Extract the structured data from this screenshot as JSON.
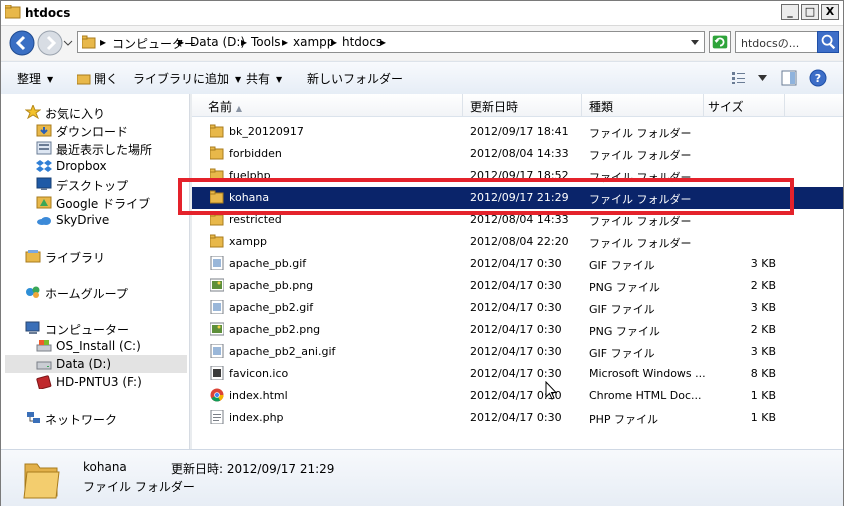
{
  "window": {
    "title": "htdocs",
    "controls": {
      "minimize": "_",
      "maximize": "□",
      "close": "X"
    }
  },
  "address": {
    "crumbs": [
      "コンピューター",
      "Data (D:)",
      "Tools",
      "xampp",
      "htdocs"
    ],
    "separator": "▸",
    "search_placeholder": "htdocsの..."
  },
  "toolbar": {
    "organize": "整理",
    "open": "開く",
    "add_to_library": "ライブラリに追加",
    "share": "共有",
    "new_folder": "新しいフォルダー"
  },
  "nav": {
    "favorites": "お気に入り",
    "downloads": "ダウンロード",
    "recent": "最近表示した場所",
    "dropbox": "Dropbox",
    "desktop": "デスクトップ",
    "google_drive": "Google ドライブ",
    "skydrive": "SkyDrive",
    "libraries": "ライブラリ",
    "homegroup": "ホームグループ",
    "computer": "コンピューター",
    "os_install": "OS_Install (C:)",
    "data_d": "Data (D:)",
    "hd_pntu3": "HD-PNTU3 (F:)",
    "network": "ネットワーク"
  },
  "columns": {
    "name": "名前",
    "modified": "更新日時",
    "type": "種類",
    "size": "サイズ"
  },
  "files": [
    {
      "name": "bk_20120917",
      "date": "2012/09/17 18:41",
      "type": "ファイル フォルダー",
      "size": "",
      "icon": "folder-icon"
    },
    {
      "name": "forbidden",
      "date": "2012/08/04 14:33",
      "type": "ファイル フォルダー",
      "size": "",
      "icon": "folder-icon"
    },
    {
      "name": "fuelphp",
      "date": "2012/09/17 18:52",
      "type": "ファイル フォルダー",
      "size": "",
      "icon": "folder-icon"
    },
    {
      "name": "kohana",
      "date": "2012/09/17 21:29",
      "type": "ファイル フォルダー",
      "size": "",
      "icon": "folder-icon",
      "selected": true
    },
    {
      "name": "restricted",
      "date": "2012/08/04 14:33",
      "type": "ファイル フォルダー",
      "size": "",
      "icon": "folder-icon"
    },
    {
      "name": "xampp",
      "date": "2012/08/04 22:20",
      "type": "ファイル フォルダー",
      "size": "",
      "icon": "folder-icon"
    },
    {
      "name": "apache_pb.gif",
      "date": "2012/04/17 0:30",
      "type": "GIF ファイル",
      "size": "3 KB",
      "icon": "gif-file-icon"
    },
    {
      "name": "apache_pb.png",
      "date": "2012/04/17 0:30",
      "type": "PNG ファイル",
      "size": "2 KB",
      "icon": "png-file-icon"
    },
    {
      "name": "apache_pb2.gif",
      "date": "2012/04/17 0:30",
      "type": "GIF ファイル",
      "size": "3 KB",
      "icon": "gif-file-icon"
    },
    {
      "name": "apache_pb2.png",
      "date": "2012/04/17 0:30",
      "type": "PNG ファイル",
      "size": "2 KB",
      "icon": "png-file-icon"
    },
    {
      "name": "apache_pb2_ani.gif",
      "date": "2012/04/17 0:30",
      "type": "GIF ファイル",
      "size": "3 KB",
      "icon": "gif-file-icon"
    },
    {
      "name": "favicon.ico",
      "date": "2012/04/17 0:30",
      "type": "Microsoft Windows ...",
      "size": "8 KB",
      "icon": "ico-file-icon"
    },
    {
      "name": "index.html",
      "date": "2012/04/17 0:30",
      "type": "Chrome HTML Doc...",
      "size": "1 KB",
      "icon": "chrome-icon"
    },
    {
      "name": "index.php",
      "date": "2012/04/17 0:30",
      "type": "PHP ファイル",
      "size": "1 KB",
      "icon": "php-file-icon"
    }
  ],
  "details": {
    "name": "kohana",
    "modified_label": "更新日時:",
    "modified_value": "2012/09/17 21:29",
    "type": "ファイル フォルダー"
  },
  "colors": {
    "selection": "#0a246a",
    "highlight_border": "#e4222b",
    "folder": "#e8b84a"
  }
}
